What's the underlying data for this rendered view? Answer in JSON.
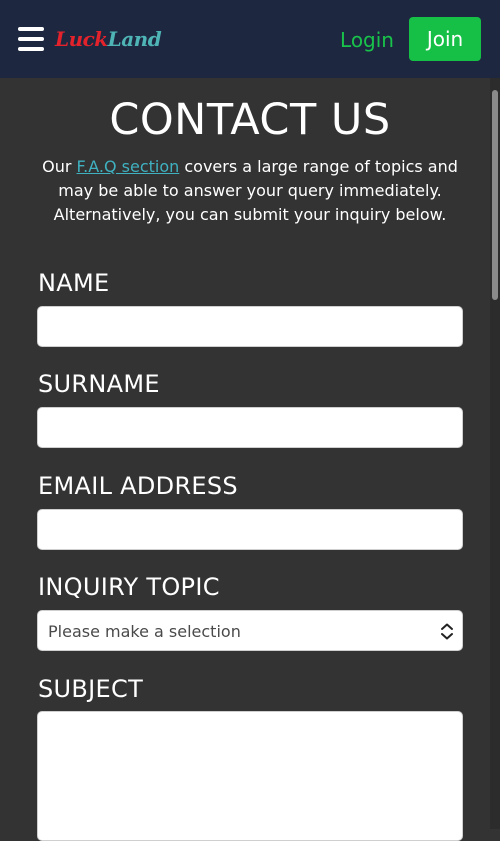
{
  "header": {
    "logo_luck": "Luck",
    "logo_land": "Land",
    "login_label": "Login",
    "join_label": "Join",
    "menu_icon": "hamburger-menu-icon"
  },
  "main": {
    "title": "CONTACT US",
    "intro_prefix": "Our ",
    "faq_link": "F.A.Q section",
    "intro_suffix": " covers a large range of topics and may be able to answer your query immediately.",
    "intro_line2": "Alternatively, you can submit your inquiry below."
  },
  "form": {
    "name_label": "NAME",
    "name_value": "",
    "surname_label": "SURNAME",
    "surname_value": "",
    "email_label": "EMAIL ADDRESS",
    "email_value": "",
    "topic_label": "INQUIRY TOPIC",
    "topic_selected": "Please make a selection",
    "subject_label": "SUBJECT",
    "subject_value": ""
  },
  "colors": {
    "header_bg": "#1d2840",
    "page_bg": "#333333",
    "accent_green": "#16c046",
    "link_teal": "#3fb1c0",
    "logo_red": "#e3222b",
    "logo_teal": "#4fb4b6"
  }
}
